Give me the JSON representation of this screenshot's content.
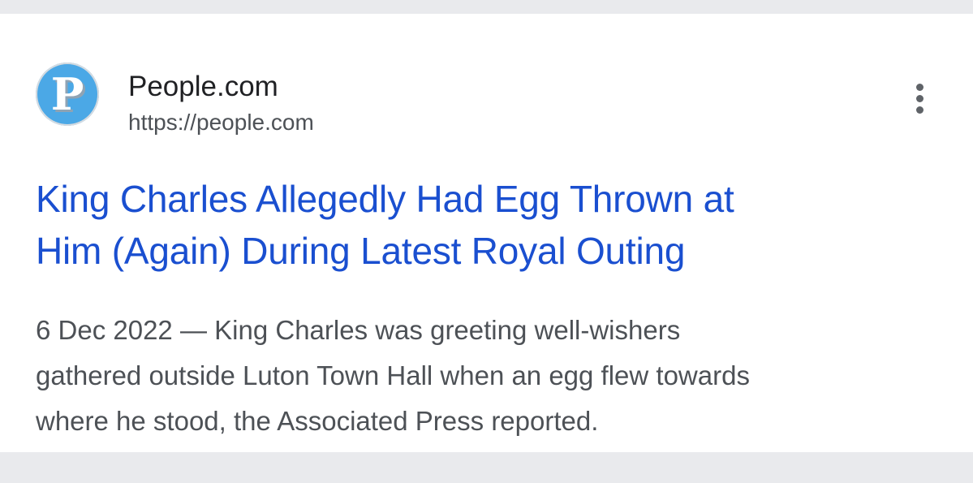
{
  "result": {
    "favicon_letter": "P",
    "favicon_color": "#4ba8e6",
    "site_name": "People.com",
    "site_url": "https://people.com",
    "more_icon": "more-vert-icon",
    "title_lines": [
      "King Charles Allegedly Had Egg Thrown at",
      "Him (Again) During Latest Royal Outing"
    ],
    "snippet_date": "6 Dec 2022",
    "snippet_separator": "—",
    "snippet_first": "King Charles was greeting well-wishers",
    "snippet_lines": [
      "gathered outside Luton Town Hall when an egg flew towards",
      "where he stood, the Associated Press reported."
    ],
    "link_color": "#1a4fd0"
  }
}
